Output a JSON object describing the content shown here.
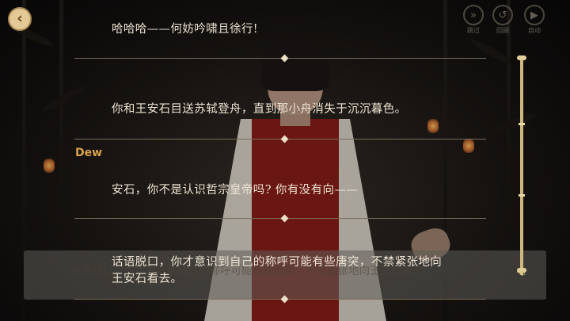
{
  "top_controls": {
    "back_glyph": "‹",
    "skip_label": "跳过",
    "replay_label": "回顾",
    "auto_label": "自动"
  },
  "log": {
    "entry1": "哈哈哈——何妨吟啸且徐行!",
    "entry2": "你和王安石目送苏轼登舟，直到那小舟消失于沉沉暮色。",
    "speaker": "Dew",
    "entry3": "安石，你不是认识哲宗皇帝吗? 你有没有向——",
    "entry4_line1": "话语脱口，你才意识到自己的称呼可能有些唐突，不禁紧张地向",
    "entry4_line2": "王安石看去。"
  },
  "dialogue": {
    "text": "话语脱口，你才意识到自己的称呼可能有些唐突，不禁紧张地向王安石看去。"
  },
  "colors": {
    "speaker": "#d8a24c",
    "text": "#ede3d2",
    "accent": "#e3c995"
  }
}
